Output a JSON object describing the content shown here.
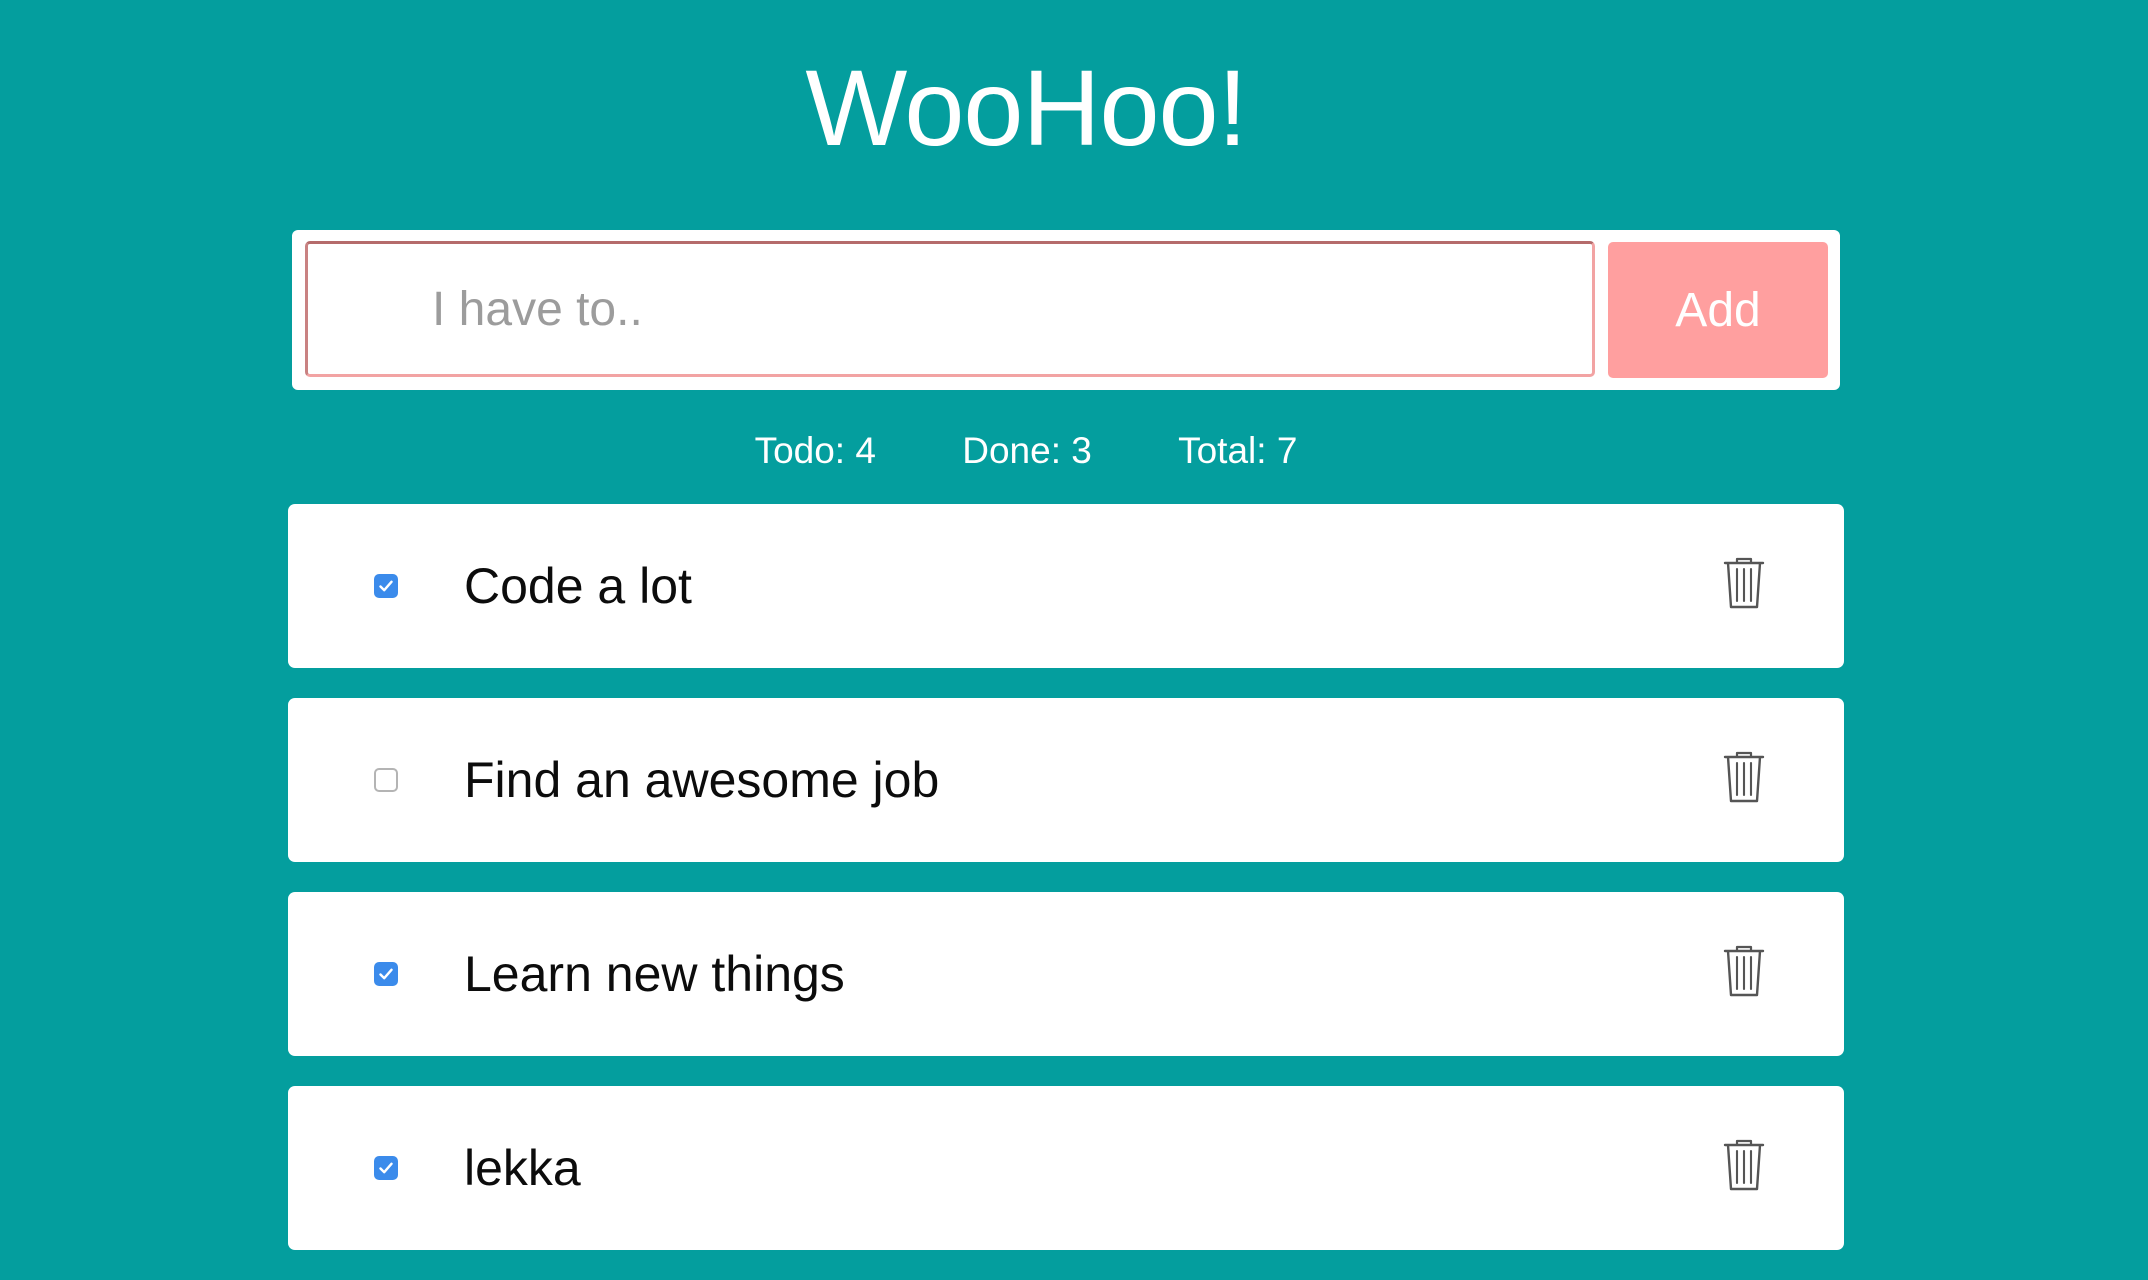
{
  "app": {
    "title": "WooHoo!"
  },
  "add_form": {
    "input_placeholder": "I have to..",
    "input_value": "",
    "add_label": "Add"
  },
  "stats": {
    "todo": "Todo: 4",
    "done": "Done: 3",
    "total": "Total: 7"
  },
  "todos": [
    {
      "text": "Code a lot",
      "checked": true,
      "icon": "trash-icon"
    },
    {
      "text": "Find an awesome job",
      "checked": false,
      "icon": "trash-icon"
    },
    {
      "text": "Learn new things",
      "checked": true,
      "icon": "trash-icon"
    },
    {
      "text": "lekka",
      "checked": true,
      "icon": "trash-icon"
    }
  ],
  "colors": {
    "background": "#049e9e",
    "card": "#ffffff",
    "accent_button": "#ff9f9f",
    "checkbox_checked": "#3b8beb",
    "input_border": "#f2a3a3"
  }
}
